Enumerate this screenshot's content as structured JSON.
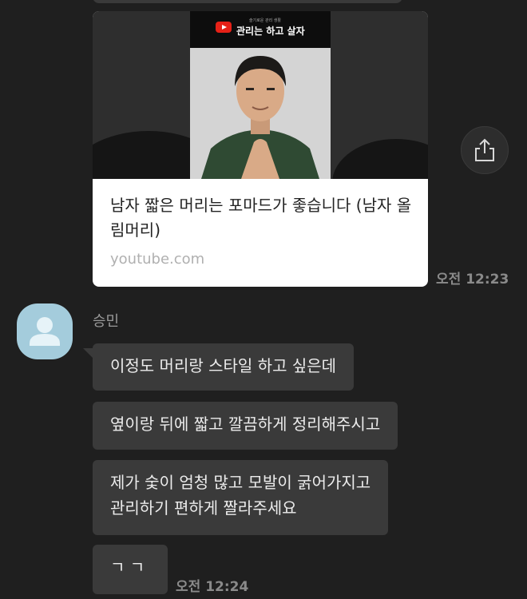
{
  "link_card": {
    "channel_name": "관리는 하고 살자",
    "channel_tagline": "슬기로운 관리 생활",
    "title": "남자 짧은 머리는 포마드가 좋습니다 (남자 올림머리)",
    "domain": "youtube.com",
    "time": "오전 12:23"
  },
  "share_button": {
    "icon": "share-icon"
  },
  "sender": {
    "name": "승민",
    "avatar_icon": "person-icon"
  },
  "messages": [
    {
      "text": "이정도 머리랑 스타일 하고 싶은데"
    },
    {
      "text": "옆이랑 뒤에 짧고 깔끔하게 정리해주시고"
    },
    {
      "text": "제가 숯이 엄청 많고 모발이 굵어가지고",
      "text2": "관리하기 편하게 짤라주세요"
    },
    {
      "text": "ㄱ ㄱ"
    }
  ],
  "last_time": "오전 12:24",
  "colors": {
    "background": "#1f1f1f",
    "bubble": "#3a3a3a",
    "avatar": "#a4ccdc"
  }
}
